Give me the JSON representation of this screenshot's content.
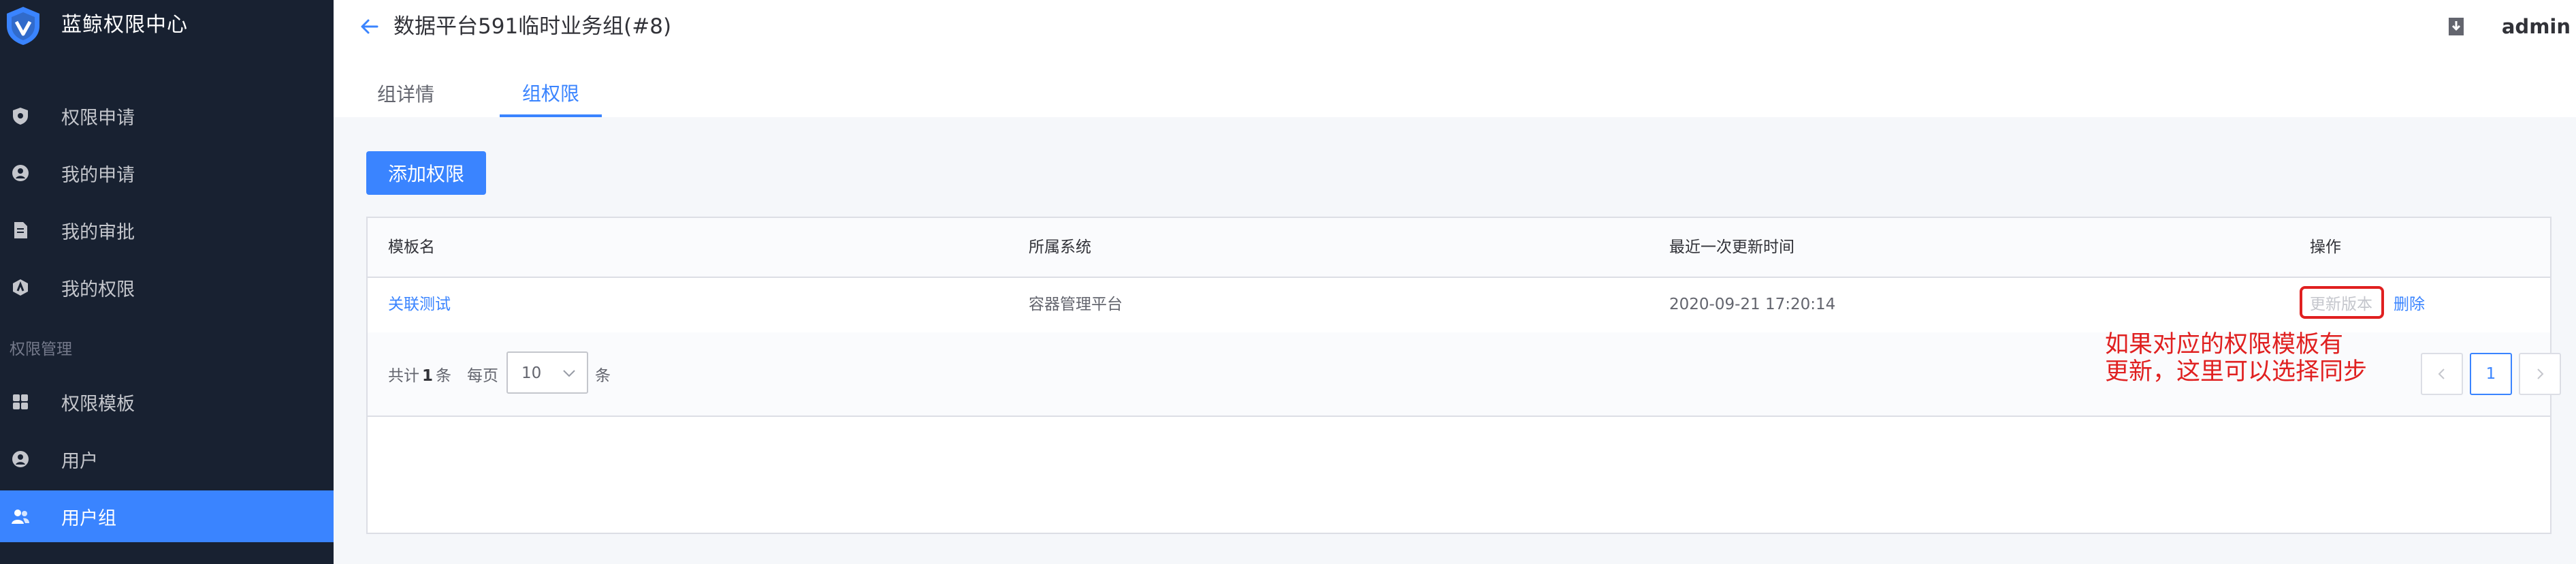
{
  "app": {
    "title": "蓝鲸权限中心",
    "user": "admin"
  },
  "sidebar": {
    "items": [
      {
        "label": "权限申请"
      },
      {
        "label": "我的申请"
      },
      {
        "label": "我的审批"
      },
      {
        "label": "我的权限"
      }
    ],
    "group_label": "权限管理",
    "group_items": [
      {
        "label": "权限模板"
      },
      {
        "label": "用户"
      },
      {
        "label": "用户组"
      }
    ]
  },
  "header": {
    "page_title": "数据平台591临时业务组(#8)",
    "tabs": [
      {
        "label": "组详情"
      },
      {
        "label": "组权限"
      }
    ],
    "active_tab": "组权限"
  },
  "main": {
    "add_button": "添加权限",
    "table": {
      "columns": [
        "模板名",
        "所属系统",
        "最近一次更新时间",
        "操作"
      ],
      "rows": [
        {
          "template": "关联测试",
          "system": "容器管理平台",
          "updated": "2020-09-21 17:20:14",
          "action_update": "更新版本",
          "action_delete": "删除"
        }
      ]
    },
    "pagination": {
      "total_prefix": "共计",
      "total": "1",
      "total_suffix": "条",
      "per_page_label": "每页",
      "page_size": "10",
      "page_size_unit": "条",
      "current_page": "1"
    }
  },
  "annotation": {
    "line1": "如果对应的权限模板有",
    "line2": "更新，这里可以选择同步",
    "color": "#e02020"
  },
  "colors": {
    "sidebar_bg": "#182131",
    "accent": "#3a84ff",
    "content_bg": "#f5f7fa"
  }
}
